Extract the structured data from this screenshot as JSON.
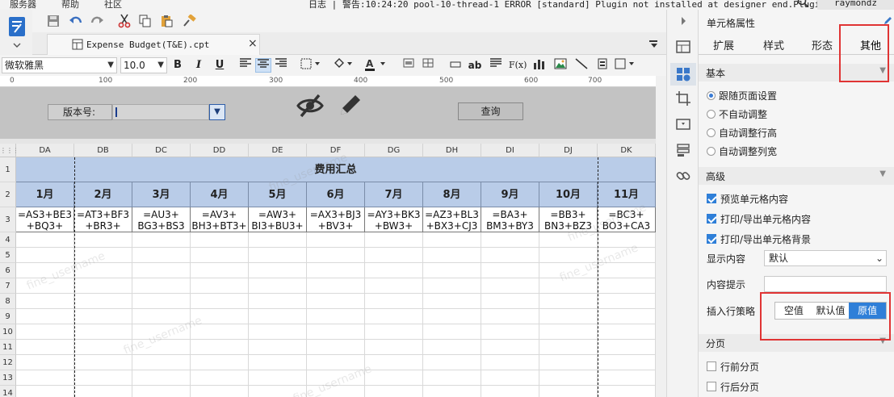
{
  "menu": {
    "server": "服务器",
    "help": "帮助",
    "community": "社区"
  },
  "log_text": "日志 | 警告:10:24:20 pool-10-thread-1 ERROR [standard] Plugin not installed at designer end.Plugi...",
  "user": "raymondz",
  "doc_tab": {
    "title": "Expense Budget(T&E).cpt",
    "close": "×"
  },
  "format": {
    "font": "微软雅黑",
    "size": "10.0",
    "bold": "B",
    "italic": "I",
    "underline": "U",
    "ab": "ab",
    "fx": "F(x)"
  },
  "ruler_marks": [
    "0",
    "100",
    "200",
    "300",
    "400",
    "500",
    "600",
    "700"
  ],
  "param": {
    "version_label": "版本号:",
    "query_button": "查询"
  },
  "columns": [
    "DA",
    "DB",
    "DC",
    "DD",
    "DE",
    "DF",
    "DG",
    "DH",
    "DI",
    "DJ",
    "DK"
  ],
  "rows": [
    "1",
    "2",
    "3",
    "4",
    "5",
    "6",
    "7",
    "8",
    "9",
    "10",
    "11",
    "12",
    "13",
    "14"
  ],
  "merged_header": "费用汇总",
  "months": [
    "1月",
    "2月",
    "3月",
    "4月",
    "5月",
    "6月",
    "7月",
    "8月",
    "9月",
    "10月",
    "11月"
  ],
  "formulas": [
    [
      "=AS3+BE3",
      "+BQ3+"
    ],
    [
      "=AT3+BF3",
      "+BR3+"
    ],
    [
      "=AU3+",
      "BG3+BS3"
    ],
    [
      "=AV3+",
      "BH3+BT3+"
    ],
    [
      "=AW3+",
      "BI3+BU3+"
    ],
    [
      "=AX3+BJ3",
      "+BV3+"
    ],
    [
      "=AY3+BK3",
      "+BW3+"
    ],
    [
      "=AZ3+BL3",
      "+BX3+CJ3"
    ],
    [
      "=BA3+",
      "BM3+BY3"
    ],
    [
      "=BB3+",
      "BN3+BZ3"
    ],
    [
      "=BC3+",
      "BO3+CA3"
    ]
  ],
  "watermark": "fine_username",
  "panel": {
    "title": "单元格属性",
    "tabs": [
      "扩展",
      "样式",
      "形态",
      "其他"
    ],
    "active_tab": "其他",
    "basic": {
      "label": "基本",
      "options": [
        "跟随页面设置",
        "不自动调整",
        "自动调整行高",
        "自动调整列宽"
      ],
      "selected": "跟随页面设置"
    },
    "advanced": {
      "label": "高级",
      "checks": [
        "预览单元格内容",
        "打印/导出单元格内容",
        "打印/导出单元格背景"
      ],
      "display_label": "显示内容",
      "display_value": "默认",
      "hint_label": "内容提示",
      "insert_label": "插入行策略",
      "insert_options": [
        "空值",
        "默认值",
        "原值"
      ],
      "insert_selected": "原值"
    },
    "paging": {
      "label": "分页",
      "checks": [
        "行前分页",
        "行后分页"
      ]
    }
  },
  "colors": {
    "header_fill": "#b9cce8",
    "accent": "#2f7fd8",
    "highlight": "#e03434",
    "param_bg": "#c3c3c3"
  }
}
